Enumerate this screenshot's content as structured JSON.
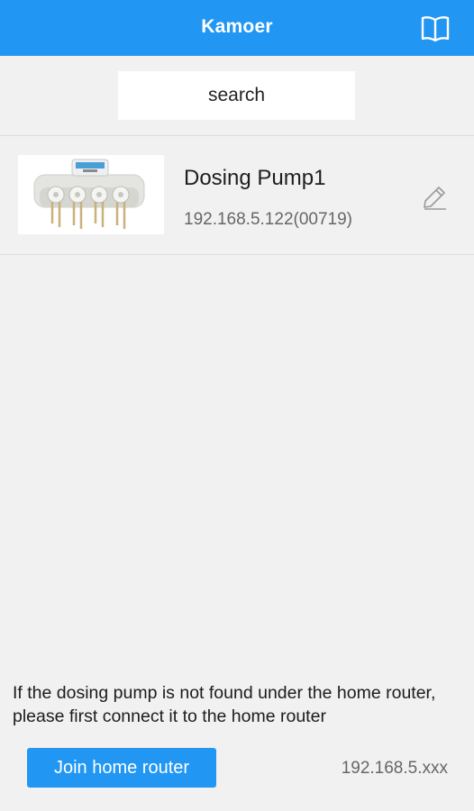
{
  "header": {
    "title": "Kamoer",
    "manual_icon": "book-icon"
  },
  "search": {
    "placeholder": "search"
  },
  "devices": [
    {
      "name": "Dosing Pump1",
      "ip": "192.168.5.122(00719)",
      "image": "dosing-pump-image",
      "edit_icon": "pencil-icon"
    }
  ],
  "footer": {
    "hint": "If the dosing pump is not found under the home router, please first connect it to the home router",
    "join_button_label": "Join home router",
    "ip_hint": "192.168.5.xxx"
  },
  "colors": {
    "accent": "#2196f3",
    "background": "#f1f1f1"
  }
}
